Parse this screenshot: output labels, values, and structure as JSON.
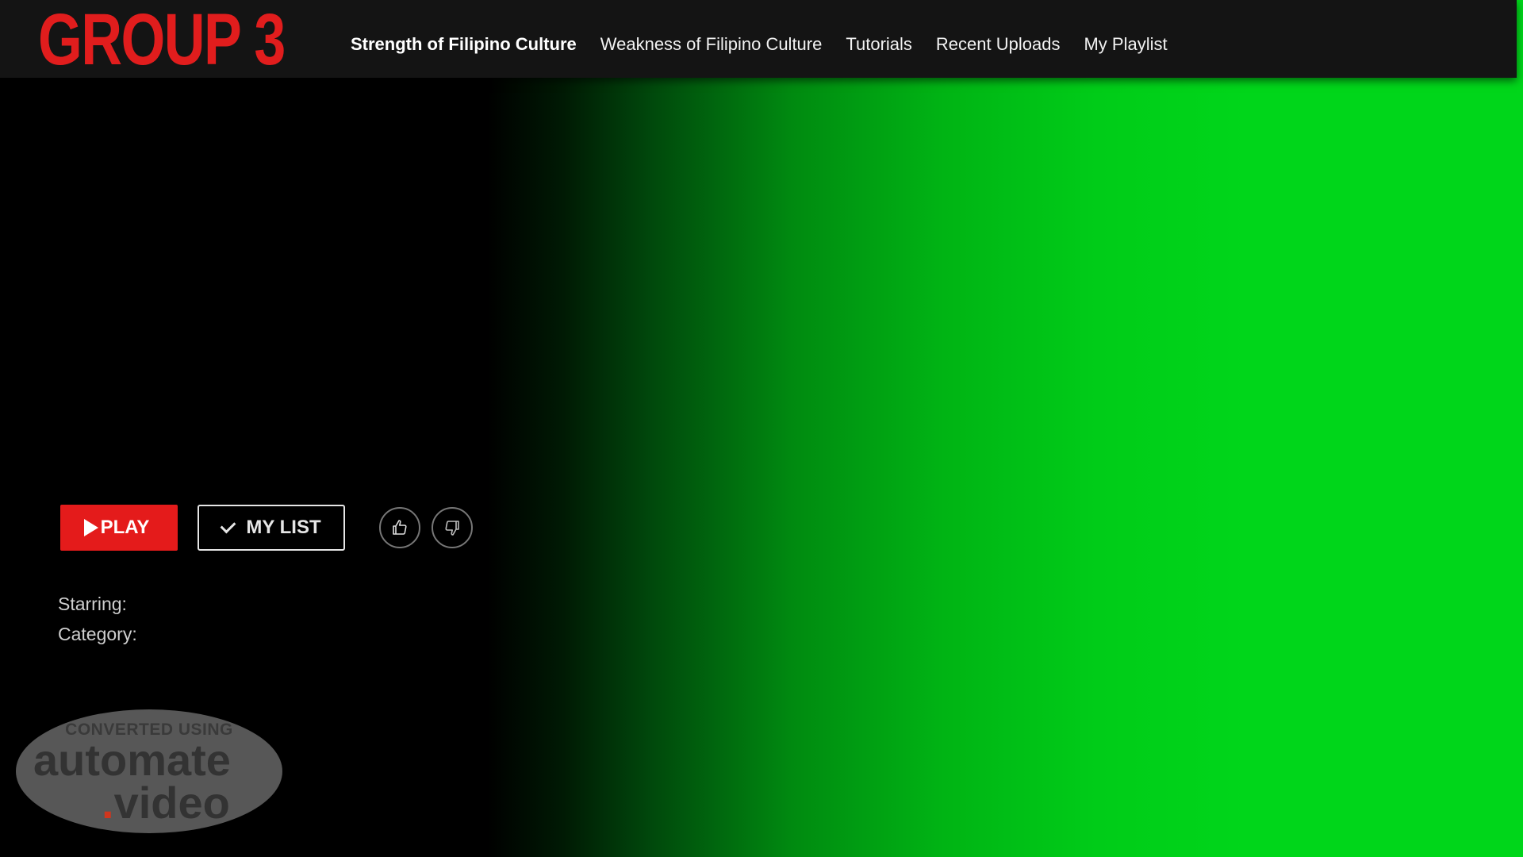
{
  "brand": {
    "logo_text": "GROUP 3",
    "logo_color": "#e11d1d"
  },
  "nav": {
    "items": [
      {
        "label": "Strength of Filipino Culture",
        "active": true
      },
      {
        "label": "Weakness of Filipino Culture",
        "active": false
      },
      {
        "label": "Tutorials",
        "active": false
      },
      {
        "label": "Recent Uploads",
        "active": false
      },
      {
        "label": "My Playlist",
        "active": false
      }
    ]
  },
  "actions": {
    "play_label": "PLAY",
    "play_icon": "play-icon",
    "mylist_label": "MY LIST",
    "mylist_icon": "check-icon",
    "like_icon": "thumbs-up-icon",
    "dislike_icon": "thumbs-down-icon",
    "play_color": "#e41b1b"
  },
  "details": {
    "starring_label": "Starring:",
    "category_label": "Category:"
  },
  "watermark": {
    "top_text": "CONVERTED USING",
    "main_text": "automate",
    "dot_text": ".",
    "sub_text": "video"
  },
  "colors": {
    "hero_gradient_start": "#000000",
    "hero_gradient_end": "#00d61a",
    "topbar_bg": "#141414"
  }
}
